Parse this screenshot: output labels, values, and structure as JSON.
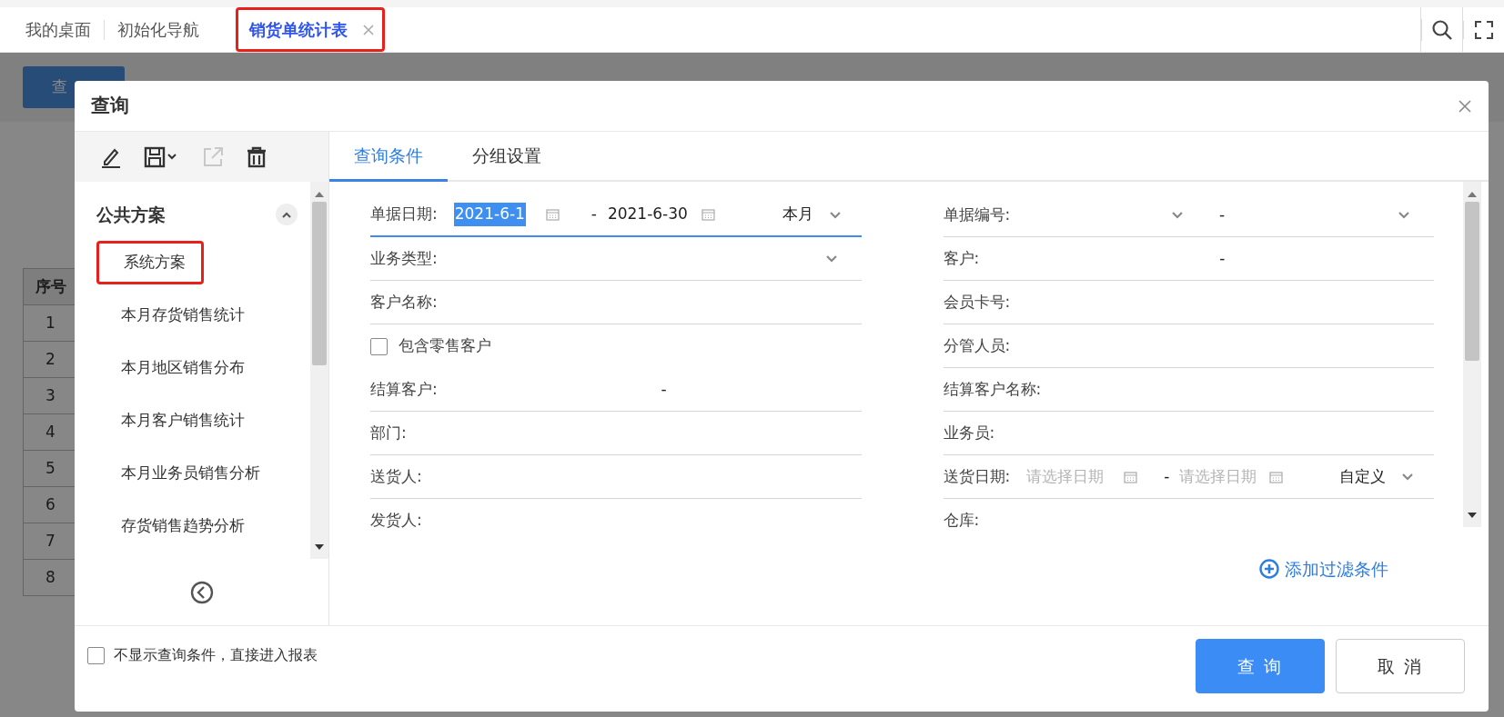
{
  "app_tabs": [
    {
      "label": "我的桌面",
      "selected": false,
      "closable": false,
      "annotated": false
    },
    {
      "label": "初始化导航",
      "selected": false,
      "closable": false,
      "annotated": false
    },
    {
      "label": "销货单统计表",
      "selected": true,
      "closable": true,
      "annotated": true
    }
  ],
  "background": {
    "query_button": "查",
    "table": {
      "header": "序号",
      "rows": [
        "1",
        "2",
        "3",
        "4",
        "5",
        "6",
        "7",
        "8"
      ]
    }
  },
  "dialog": {
    "title": "查询",
    "toolbar": [
      {
        "kind": "edit",
        "disabled": false
      },
      {
        "kind": "save",
        "disabled": false
      },
      {
        "kind": "export",
        "disabled": true
      },
      {
        "kind": "delete",
        "disabled": false
      }
    ],
    "scheme_group": {
      "label": "公共方案",
      "expanded": true
    },
    "schemes": [
      {
        "label": "系统方案",
        "annotated": true
      },
      {
        "label": "本月存货销售统计",
        "annotated": false
      },
      {
        "label": "本月地区销售分布",
        "annotated": false
      },
      {
        "label": "本月客户销售统计",
        "annotated": false
      },
      {
        "label": "本月业务员销售分析",
        "annotated": false
      },
      {
        "label": "存货销售趋势分析",
        "annotated": false
      }
    ],
    "tabs": [
      {
        "label": "查询条件",
        "selected": true
      },
      {
        "label": "分组设置",
        "selected": false
      }
    ],
    "fields_left": [
      {
        "kind": "date_range",
        "label": "单据日期:",
        "from": "2021-6-1",
        "from_highlighted": true,
        "separator": "-",
        "to": "2021-6-30",
        "period": "本月",
        "focused": true
      },
      {
        "kind": "select",
        "label": "业务类型:"
      },
      {
        "kind": "text",
        "label": "客户名称:"
      },
      {
        "kind": "checkbox",
        "label": "包含零售客户",
        "checked": false
      },
      {
        "kind": "range",
        "label": "结算客户:",
        "separator": "-"
      },
      {
        "kind": "text",
        "label": "部门:"
      },
      {
        "kind": "text",
        "label": "送货人:"
      },
      {
        "kind": "last",
        "label": "发货人:"
      }
    ],
    "fields_right": [
      {
        "kind": "select_range",
        "label": "单据编号:",
        "separator": "-"
      },
      {
        "kind": "range",
        "label": "客户:",
        "separator": "-"
      },
      {
        "kind": "text",
        "label": "会员卡号:"
      },
      {
        "kind": "text",
        "label": "分管人员:"
      },
      {
        "kind": "text",
        "label": "结算客户名称:"
      },
      {
        "kind": "text",
        "label": "业务员:"
      },
      {
        "kind": "date_range",
        "label": "送货日期:",
        "from_placeholder": "请选择日期",
        "separator": "-",
        "to_placeholder": "请选择日期",
        "period": "自定义",
        "focused": false
      },
      {
        "kind": "last",
        "label": "仓库:"
      }
    ],
    "add_filter": "添加过滤条件",
    "skip_option": {
      "label": "不显示查询条件，直接进入报表",
      "checked": false
    },
    "buttons": [
      {
        "label": "查 询",
        "kind": "primary"
      },
      {
        "label": "取 消",
        "kind": "secondary"
      }
    ]
  }
}
